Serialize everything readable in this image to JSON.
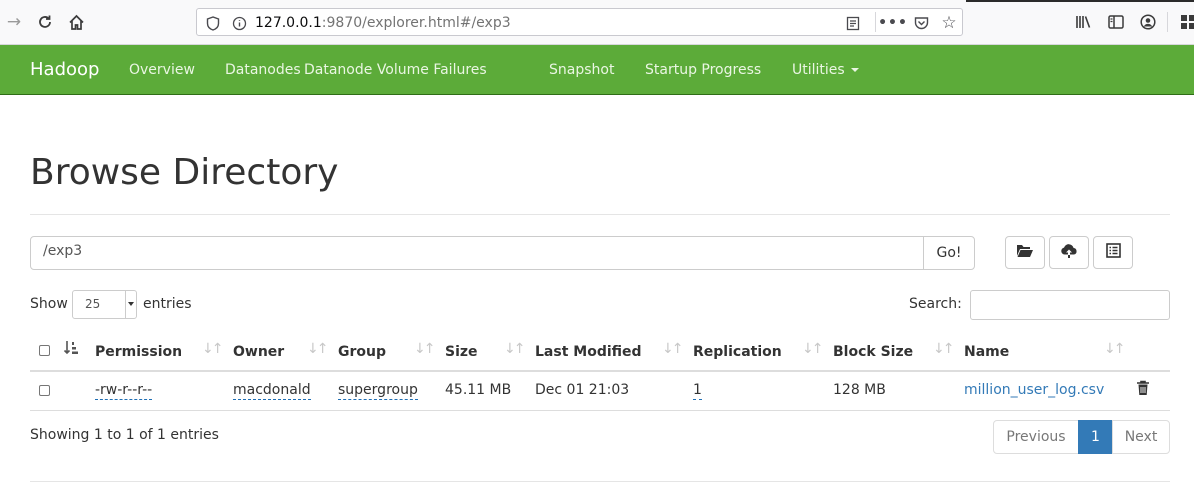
{
  "browser": {
    "url_host": "127.0.0.1",
    "url_rest": ":9870/explorer.html#/exp3"
  },
  "nav": {
    "brand": "Hadoop",
    "items": [
      "Overview",
      "Datanodes",
      "Datanode Volume Failures",
      "Snapshot",
      "Startup Progress",
      "Utilities"
    ]
  },
  "page": {
    "title": "Browse Directory",
    "path_value": "/exp3",
    "go_label": "Go!"
  },
  "table_controls": {
    "show_label": "Show",
    "page_length": "25",
    "entries_label": "entries",
    "search_label": "Search:"
  },
  "table": {
    "columns": [
      "Permission",
      "Owner",
      "Group",
      "Size",
      "Last Modified",
      "Replication",
      "Block Size",
      "Name"
    ],
    "rows": [
      {
        "permission": "-rw-r--r--",
        "owner": "macdonald",
        "group": "supergroup",
        "size": "45.11 MB",
        "last_modified": "Dec 01 21:03",
        "replication": "1",
        "block_size": "128 MB",
        "name": "million_user_log.csv"
      }
    ]
  },
  "footer": {
    "info": "Showing 1 to 1 of 1 entries",
    "previous": "Previous",
    "current_page": "1",
    "next": "Next"
  },
  "colors": {
    "navbar": "#5cab39",
    "link": "#337ab7",
    "active_page": "#337ab7"
  }
}
